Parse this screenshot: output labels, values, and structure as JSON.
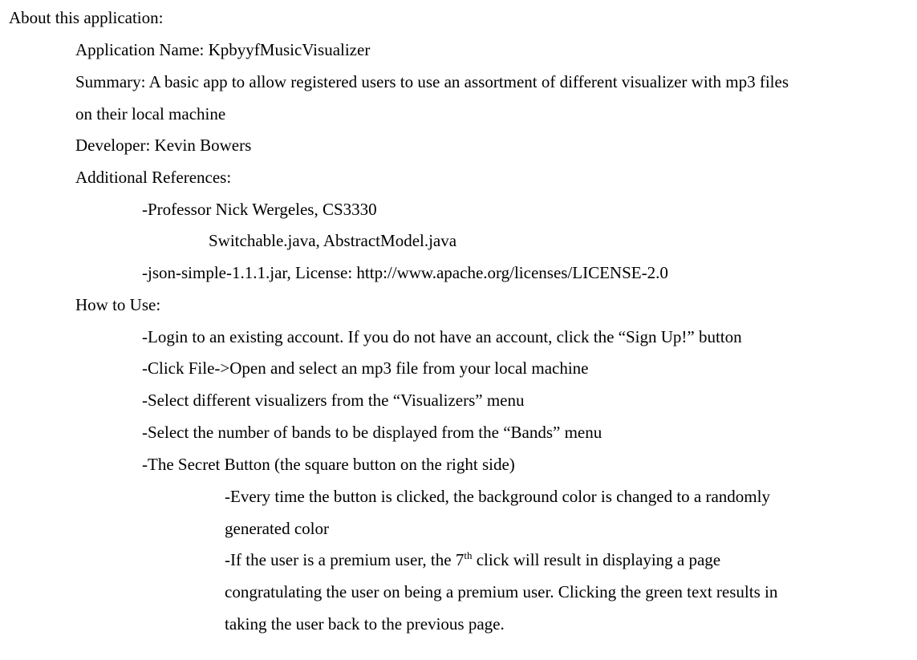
{
  "heading": "About this application:",
  "app_name": "Application Name: KpbyyfMusicVisualizer",
  "summary": {
    "line1": "Summary: A basic app to allow registered users to use an assortment of different visualizer with mp3 files",
    "line2": "on their local machine"
  },
  "developer": "Developer: Kevin Bowers",
  "references": {
    "label": "Additional References:",
    "professor": "-Professor Nick Wergeles, CS3330",
    "files": "Switchable.java, AbstractModel.java",
    "json_lib": "-json-simple-1.1.1.jar, License: http://www.apache.org/licenses/LICENSE-2.0"
  },
  "how_to_use": {
    "label": "How to Use:",
    "steps": [
      "-Login to an existing account. If you do not have an account, click the “Sign Up!” button",
      "-Click File->Open and select an mp3 file from your local machine",
      "-Select different visualizers from the “Visualizers” menu",
      "-Select the number of bands to be displayed from the “Bands” menu",
      "-The Secret Button (the square button on the right side)"
    ],
    "secret": {
      "color_line1": "-Every time the button is clicked, the background color is changed to a randomly",
      "color_line2": "generated color",
      "premium_line1_pre": "-If the user is a premium user, the 7",
      "premium_line1_sup": "th",
      "premium_line1_post": " click will result in displaying a page",
      "premium_line2": "congratulating the user on being a premium user. Clicking the green text results in",
      "premium_line3": "taking the user back to the previous page."
    }
  }
}
